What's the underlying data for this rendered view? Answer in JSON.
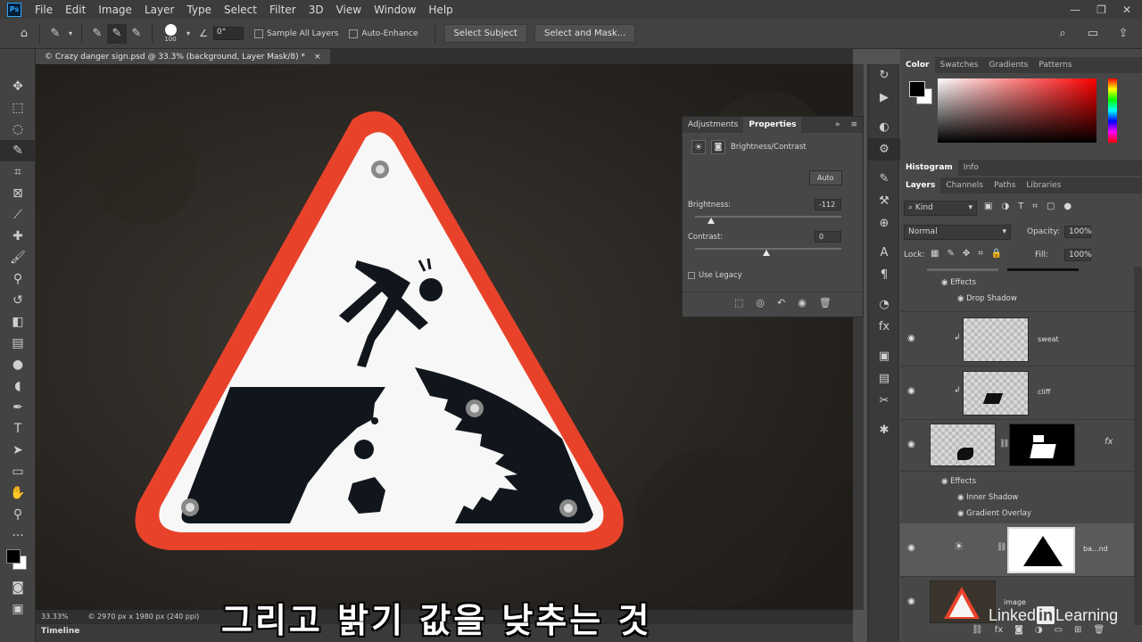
{
  "app": {
    "logo": "Ps",
    "menu": [
      "File",
      "Edit",
      "Image",
      "Layer",
      "Type",
      "Select",
      "Filter",
      "3D",
      "View",
      "Window",
      "Help"
    ]
  },
  "options": {
    "brush_size": "100",
    "angle": "0°",
    "sample_all_layers": "Sample All Layers",
    "auto_enhance": "Auto-Enhance",
    "select_subject": "Select Subject",
    "select_and_mask": "Select and Mask..."
  },
  "document": {
    "tab_title": "© Crazy danger sign.psd @ 33.3% (background, Layer Mask/8) *",
    "zoom": "33.33%",
    "info": "© 2970 px x 1980 px (240 ppi)",
    "timeline": "Timeline"
  },
  "properties": {
    "tab_adjustments": "Adjustments",
    "tab_properties": "Properties",
    "title": "Brightness/Contrast",
    "auto": "Auto",
    "brightness_label": "Brightness:",
    "brightness_value": "-112",
    "contrast_label": "Contrast:",
    "contrast_value": "0",
    "use_legacy": "Use Legacy"
  },
  "color_panel": {
    "tabs": [
      "Color",
      "Swatches",
      "Gradients",
      "Patterns"
    ],
    "foreground": "#000000",
    "background": "#ffffff",
    "hue": "#ff0000"
  },
  "histogram_tabs": [
    "Histogram",
    "Info"
  ],
  "layers_panel": {
    "tabs": [
      "Layers",
      "Channels",
      "Paths",
      "Libraries"
    ],
    "filter": "Kind",
    "blend_mode": "Normal",
    "opacity_label": "Opacity:",
    "opacity": "100%",
    "lock_label": "Lock:",
    "fill_label": "Fill:",
    "fill": "100%",
    "effects_label": "Effects",
    "drop_shadow": "Drop Shadow",
    "layers": [
      {
        "name": "sweat"
      },
      {
        "name": "cliff"
      },
      {
        "name": ""
      },
      {
        "name": "ba...nd"
      },
      {
        "name": "image"
      }
    ],
    "inner_shadow": "Inner Shadow",
    "gradient_overlay": "Gradient Overlay"
  },
  "subtitle": "그리고 밝기 값을 낮추는 것",
  "watermark": {
    "before": "Linked",
    "in": "in",
    "after": "Learning"
  }
}
